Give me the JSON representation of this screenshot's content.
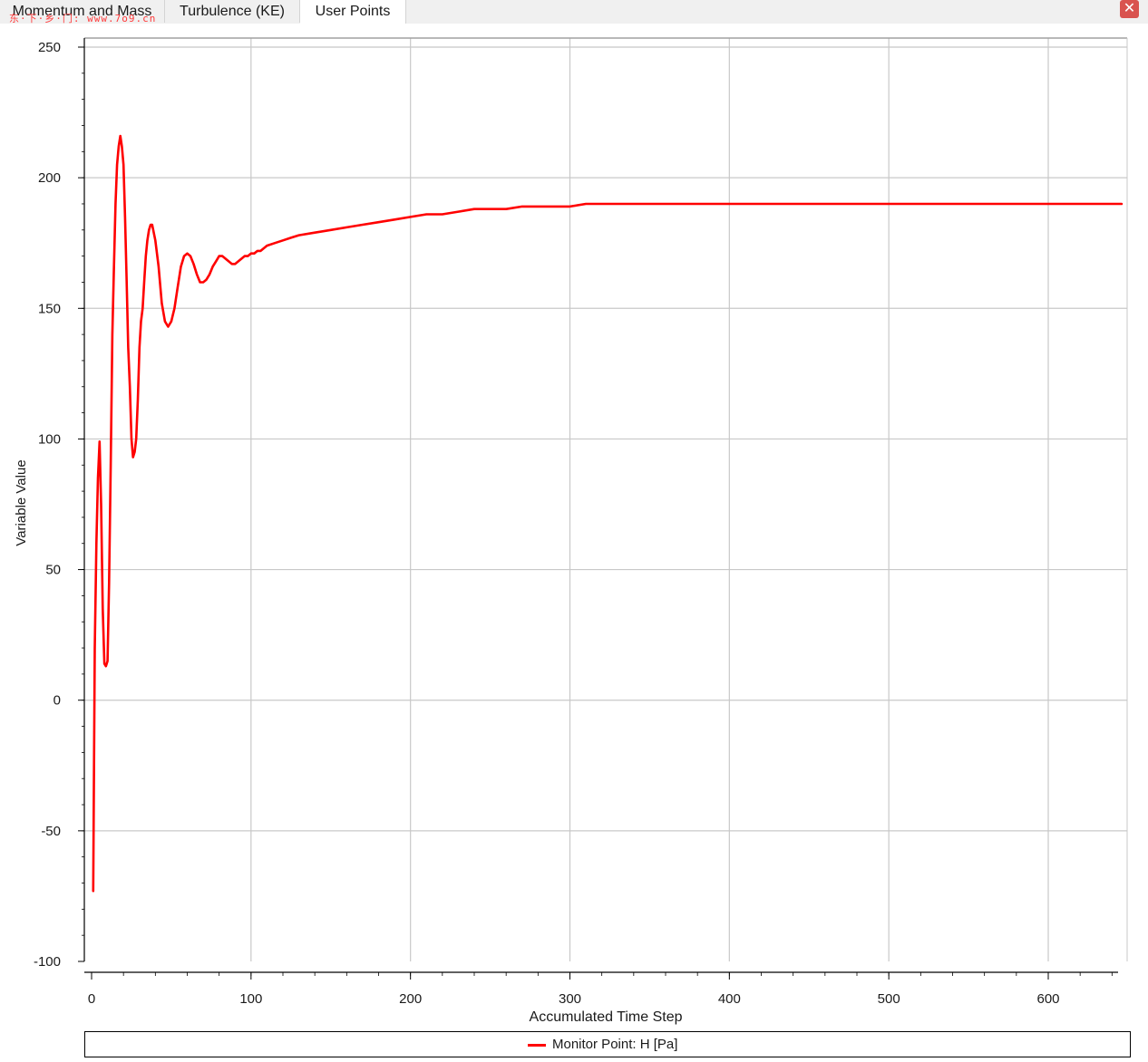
{
  "tabs": [
    {
      "label": "Momentum and Mass",
      "active": false
    },
    {
      "label": "Turbulence (KE)",
      "active": false
    },
    {
      "label": "User Points",
      "active": true
    }
  ],
  "watermark": "东·下·乡·门: www.7o9.cn",
  "close_icon": "close-icon",
  "colors": {
    "series": "#ff0000",
    "grid": "#c8c8c8",
    "axis": "#000000"
  },
  "chart_data": {
    "type": "line",
    "xlabel": "Accumulated Time Step",
    "ylabel": "Variable Value",
    "xlim": [
      -5,
      650
    ],
    "ylim": [
      -100,
      250
    ],
    "xticks": [
      0,
      100,
      200,
      300,
      400,
      500,
      600
    ],
    "yticks": [
      -100,
      -50,
      0,
      50,
      100,
      150,
      200,
      250
    ],
    "grid": true,
    "legend_position": "bottom",
    "series": [
      {
        "name": "Monitor Point: H [Pa]",
        "x": [
          1,
          2,
          3,
          4,
          5,
          6,
          7,
          8,
          9,
          10,
          11,
          12,
          13,
          14,
          15,
          16,
          17,
          18,
          19,
          20,
          21,
          22,
          23,
          24,
          25,
          26,
          27,
          28,
          29,
          30,
          31,
          32,
          33,
          34,
          35,
          36,
          37,
          38,
          40,
          42,
          44,
          46,
          48,
          50,
          52,
          54,
          56,
          58,
          60,
          62,
          64,
          66,
          68,
          70,
          72,
          74,
          76,
          78,
          80,
          82,
          84,
          86,
          88,
          90,
          92,
          94,
          96,
          98,
          100,
          102,
          104,
          106,
          108,
          110,
          115,
          120,
          125,
          130,
          140,
          150,
          160,
          170,
          180,
          190,
          200,
          210,
          220,
          230,
          240,
          250,
          260,
          270,
          280,
          290,
          300,
          310,
          320,
          340,
          400,
          500,
          600,
          646
        ],
        "y": [
          -73,
          20,
          60,
          85,
          99,
          75,
          35,
          14,
          13,
          15,
          45,
          90,
          140,
          165,
          190,
          205,
          212,
          216,
          212,
          205,
          185,
          160,
          135,
          120,
          100,
          93,
          95,
          100,
          115,
          135,
          145,
          150,
          160,
          170,
          176,
          180,
          182,
          182,
          176,
          166,
          152,
          145,
          143,
          145,
          150,
          158,
          166,
          170,
          171,
          170,
          167,
          163,
          160,
          160,
          161,
          163,
          166,
          168,
          170,
          170,
          169,
          168,
          167,
          167,
          168,
          169,
          170,
          170,
          171,
          171,
          172,
          172,
          173,
          174,
          175,
          176,
          177,
          178,
          179,
          180,
          181,
          182,
          183,
          184,
          185,
          186,
          186,
          187,
          188,
          188,
          188,
          189,
          189,
          189,
          189,
          190,
          190,
          190,
          190,
          190,
          190,
          190
        ],
        "color": "#ff0000"
      }
    ]
  }
}
